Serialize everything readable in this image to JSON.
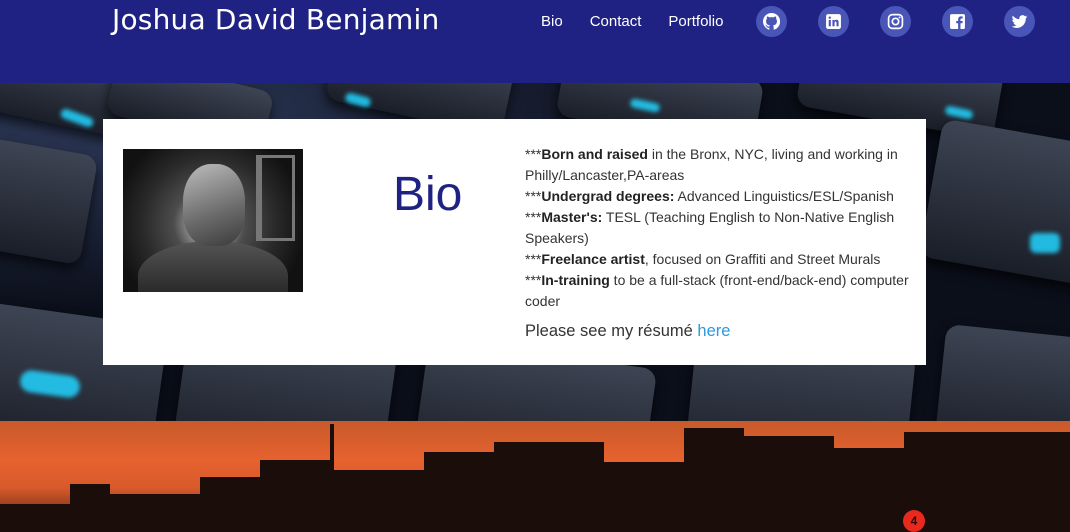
{
  "header": {
    "title": "Joshua David Benjamin",
    "nav": [
      "Bio",
      "Contact",
      "Portfolio"
    ],
    "socials": [
      "github-icon",
      "linkedin-icon",
      "instagram-icon",
      "facebook-icon",
      "twitter-icon"
    ]
  },
  "bio_card": {
    "heading": "Bio",
    "lines": [
      {
        "prefix": "***",
        "bold": "Born and raised",
        "rest": " in the Bronx, NYC, living and working in Philly/Lancaster,PA-areas"
      },
      {
        "prefix": "***",
        "bold": "Undergrad degrees:",
        "rest": " Advanced Linguistics/ESL/Spanish"
      },
      {
        "prefix": "***",
        "bold": "Master's:",
        "rest": " TESL (Teaching English to Non-Native English Speakers)"
      },
      {
        "prefix": "***",
        "bold": "Freelance artist",
        "rest": ", focused on Graffiti and Street Murals"
      },
      {
        "prefix": "***",
        "bold": "In-training",
        "rest": " to be a full-stack (front-end/back-end) computer coder"
      }
    ],
    "resume_text": "Please see my résumé ",
    "resume_link": "here"
  },
  "colors": {
    "header_bg": "#1f2282",
    "heading": "#1f2282",
    "link": "#2b9ae0",
    "social_bg": "#4a55b8"
  }
}
